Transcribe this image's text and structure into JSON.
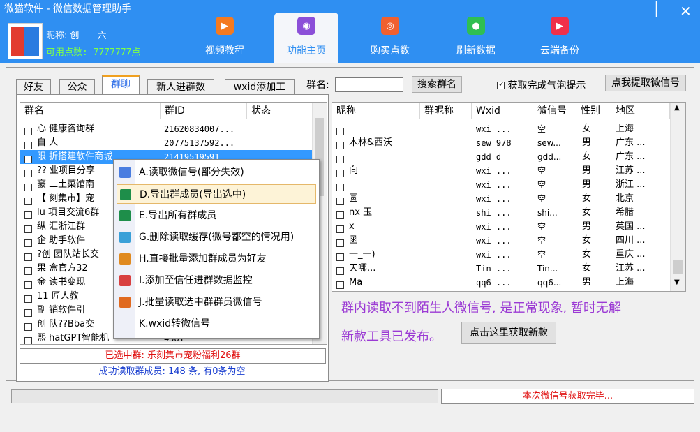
{
  "window": {
    "title": "微猫软件 - 微信数据管理助手",
    "nick_label": "昵称: 创",
    "nick_suffix": "六",
    "points": "可用点数: 7777777点",
    "min_glyph": "|",
    "close_glyph": "✕"
  },
  "nav": [
    {
      "label": "视频教程",
      "icon": "video-icon",
      "color": "#f47a20",
      "glyph": "▶"
    },
    {
      "label": "功能主页",
      "icon": "home-icon",
      "color": "#8b4fd8",
      "glyph": "◉"
    },
    {
      "label": "购买点数",
      "icon": "coin-icon",
      "color": "#f06030",
      "glyph": "◎"
    },
    {
      "label": "刷新数据",
      "icon": "refresh-icon",
      "color": "#2fbf52",
      "glyph": "●"
    },
    {
      "label": "云端备份",
      "icon": "cloud-upload-icon",
      "color": "#f0304a",
      "glyph": "▶"
    }
  ],
  "tabs": [
    "好友",
    "公众号",
    "群聊",
    "新人进群数据",
    "wxid添加工具"
  ],
  "search": {
    "label": "群名:",
    "value": "",
    "button": "搜索群名",
    "bubble_label": "获取完成气泡提示",
    "bubble_checked": true,
    "extract_button": "点我提取微信号"
  },
  "groups": {
    "headers": [
      "群名",
      "群ID",
      "状态"
    ],
    "rows": [
      {
        "name": "心 健康咨询群",
        "id": "21620834007..."
      },
      {
        "name": "自 人",
        "id": "20775137592..."
      },
      {
        "name": "限 折搭建软件商城",
        "id": "21419519591"
      },
      {
        "name": "?? 业项目分享",
        "id": ""
      },
      {
        "name": "豪 二土菜馆南",
        "id": ""
      },
      {
        "name": "【 刻集市】宠",
        "id": ""
      },
      {
        "name": "lu 项目交流6群",
        "id": ""
      },
      {
        "name": "纵 汇浙江群",
        "id": ""
      },
      {
        "name": "企 助手软件",
        "id": ""
      },
      {
        "name": "?创 团队站长交",
        "id": ""
      },
      {
        "name": "果 盒官方32",
        "id": ""
      },
      {
        "name": "金 读书变现",
        "id": ""
      },
      {
        "name": "11 匠人教",
        "id": ""
      },
      {
        "name": "副 销软件引",
        "id": ""
      },
      {
        "name": "创 队??Bba交",
        "id": ""
      },
      {
        "name": "熙 hatGPT智能机",
        "id": "4581"
      }
    ]
  },
  "context_menu": [
    {
      "label": "A.读取微信号(部分失效)",
      "icon": "read-icon",
      "color": "#4a7de0"
    },
    {
      "label": "D.导出群成员(导出选中)",
      "icon": "excel-icon",
      "color": "#1e8e4a"
    },
    {
      "label": "E.导出所有群成员",
      "icon": "excel-icon",
      "color": "#1e8e4a"
    },
    {
      "label": "G.删除读取缓存(微号都空的情况用)",
      "icon": "document-icon",
      "color": "#3aa0d8"
    },
    {
      "label": "H.直接批量添加群成员为好友",
      "icon": "pie-chart-icon",
      "color": "#e08a20"
    },
    {
      "label": "I.添加至信任进群数据监控",
      "icon": "shield-icon",
      "color": "#d84040"
    },
    {
      "label": "J.批量读取选中群群员微信号",
      "icon": "bar-chart-icon",
      "color": "#e06a20"
    },
    {
      "label": "K.wxid转微信号",
      "icon": "",
      "color": ""
    }
  ],
  "selected_group": "已选中群: 乐刻集市宠粉福利26群",
  "read_status": "成功读取群成员: 148 条, 有0条为空",
  "members": {
    "headers": [
      "昵称",
      "群昵称",
      "Wxid",
      "微信号",
      "性别",
      "地区"
    ],
    "rows": [
      {
        "nick": "",
        "gnick": "",
        "wxid": "wxi ...",
        "wx": "空",
        "sex": "女",
        "region": "上海"
      },
      {
        "nick": "木林&西沃",
        "gnick": "",
        "wxid": "sew 978",
        "wx": "sew...",
        "sex": "男",
        "region": "广东 ..."
      },
      {
        "nick": "",
        "gnick": "",
        "wxid": "gdd d",
        "wx": "gdd...",
        "sex": "女",
        "region": "广东 ..."
      },
      {
        "nick": "向",
        "gnick": "",
        "wxid": "wxi ...",
        "wx": "空",
        "sex": "男",
        "region": "江苏 ..."
      },
      {
        "nick": "",
        "gnick": "",
        "wxid": "wxi ...",
        "wx": "空",
        "sex": "男",
        "region": "浙江 ..."
      },
      {
        "nick": "圆",
        "gnick": "",
        "wxid": "wxi ...",
        "wx": "空",
        "sex": "女",
        "region": "北京"
      },
      {
        "nick": "nx 玉",
        "gnick": "",
        "wxid": "shi ...",
        "wx": "shi...",
        "sex": "女",
        "region": "希腊"
      },
      {
        "nick": "x",
        "gnick": "",
        "wxid": "wxi ...",
        "wx": "空",
        "sex": "男",
        "region": "英国 ..."
      },
      {
        "nick": "函",
        "gnick": "",
        "wxid": "wxi ...",
        "wx": "空",
        "sex": "女",
        "region": "四川 ..."
      },
      {
        "nick": "一_一)",
        "gnick": "",
        "wxid": "wxi ...",
        "wx": "空",
        "sex": "女",
        "region": "重庆 ..."
      },
      {
        "nick": "天哪...",
        "gnick": "",
        "wxid": "Tin ...",
        "wx": "Tin...",
        "sex": "女",
        "region": "江苏 ..."
      },
      {
        "nick": "Ma",
        "gnick": "",
        "wxid": "qq6 ...",
        "wx": "qq6...",
        "sex": "男",
        "region": "上海"
      }
    ]
  },
  "notice": {
    "line1": "群内读取不到陌生人微信号, 是正常现象, 暂时无解",
    "line2": "新款工具已发布。",
    "button": "点击这里获取新款"
  },
  "progress": {
    "fraction": 0
  },
  "bottom_status": "本次微信号获取完毕..."
}
